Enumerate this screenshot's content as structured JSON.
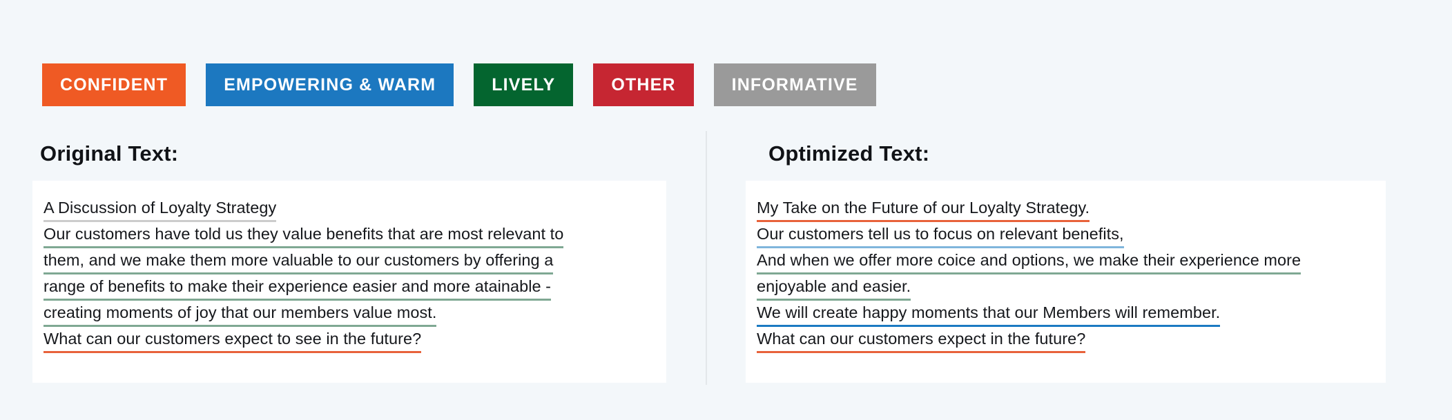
{
  "page": {
    "background_color": "#f3f7fa",
    "panel_background_color": "#ffffff",
    "divider_color": "#e3e7ea",
    "text_color": "#16181c"
  },
  "legend": {
    "items": [
      {
        "label": "CONFIDENT",
        "color": "#ef5a24",
        "underline_color": "#e8623a"
      },
      {
        "label": "EMPOWERING & WARM",
        "color": "#1c78c0",
        "underline_color": "#7fb5dc"
      },
      {
        "label": "LIVELY",
        "color": "#04652f",
        "underline_color": "#7fa893"
      },
      {
        "label": "OTHER",
        "color": "#c62632",
        "underline_color": "#c62632"
      },
      {
        "label": "INFORMATIVE",
        "color": "#9a9a9a",
        "underline_color": "#cccccc"
      }
    ]
  },
  "columns": {
    "original": {
      "heading": "Original Text:",
      "lines": [
        {
          "text": "A Discussion of Loyalty Strategy",
          "tone": "INFORMATIVE",
          "underline_color": "#cccccc"
        },
        {
          "text": "Our customers have told us they value benefits that are most relevant to",
          "tone": "LIVELY",
          "underline_color": "#7fa893"
        },
        {
          "text": "them, and we make them more valuable to our customers by offering a",
          "tone": "LIVELY",
          "underline_color": "#7fa893"
        },
        {
          "text": "range of benefits to make their experience easier and more atainable -",
          "tone": "LIVELY",
          "underline_color": "#7fa893"
        },
        {
          "text": "creating moments of joy that our members value most.",
          "tone": "LIVELY",
          "underline_color": "#7fa893"
        },
        {
          "text": "What can our customers expect to see in the future?",
          "tone": "CONFIDENT",
          "underline_color": "#e8623a"
        }
      ]
    },
    "optimized": {
      "heading": "Optimized Text:",
      "lines": [
        {
          "text": "My Take on the Future of our Loyalty Strategy.",
          "tone": "CONFIDENT",
          "underline_color": "#e8623a"
        },
        {
          "text": "Our customers tell us to focus on relevant benefits,",
          "tone": "EMPOWERING & WARM",
          "underline_color": "#7fb5dc"
        },
        {
          "text": "And when we offer more coice and options, we make their experience more",
          "tone": "LIVELY",
          "underline_color": "#7fa893"
        },
        {
          "text": "enjoyable and easier.",
          "tone": "LIVELY",
          "underline_color": "#7fa893"
        },
        {
          "text": "We will create happy moments that our Members will remember.",
          "tone": "EMPOWERING & WARM",
          "underline_color": "#1b7ac2"
        },
        {
          "text": "What can our customers expect in the future?",
          "tone": "CONFIDENT",
          "underline_color": "#e8623a"
        }
      ]
    }
  }
}
